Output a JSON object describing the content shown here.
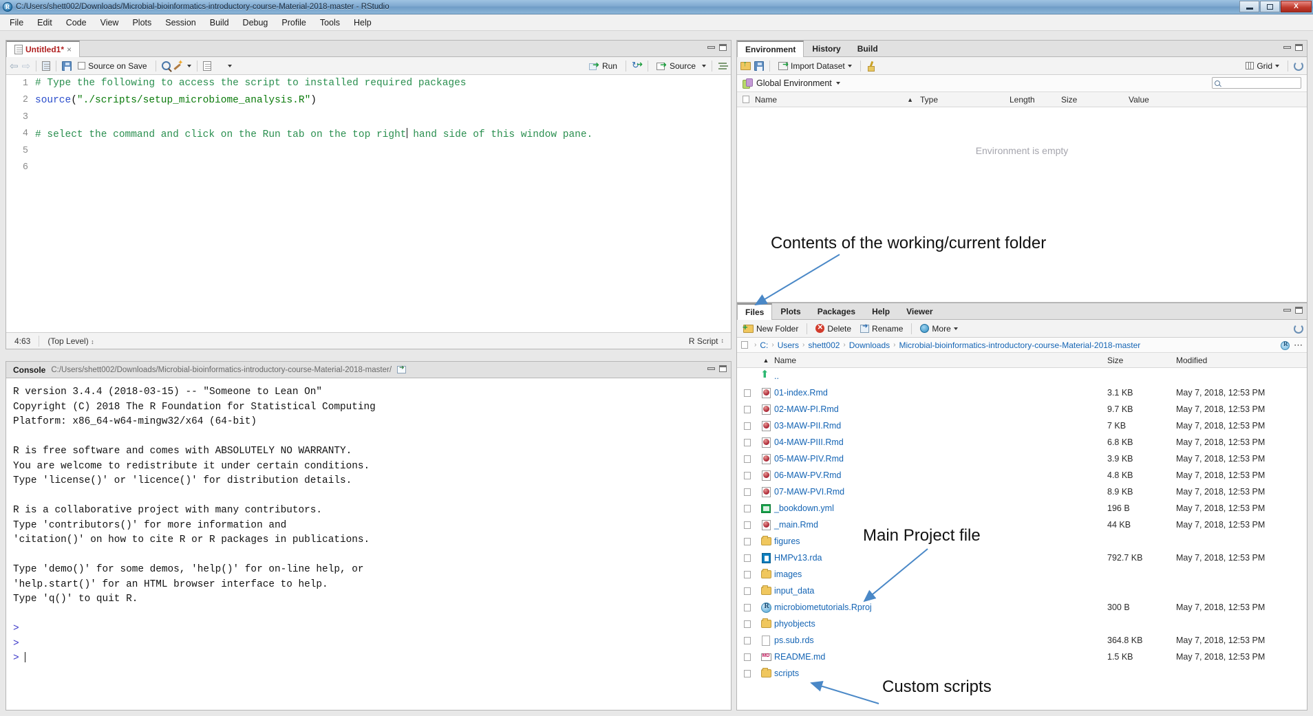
{
  "window": {
    "title": "C:/Users/shett002/Downloads/Microbial-bioinformatics-introductory-course-Material-2018-master - RStudio",
    "app_icon": "rstudio-icon",
    "minimize": "minimize-icon",
    "maximize": "maximize-icon",
    "close": "X"
  },
  "menubar": [
    "File",
    "Edit",
    "Code",
    "View",
    "Plots",
    "Session",
    "Build",
    "Debug",
    "Profile",
    "Tools",
    "Help"
  ],
  "source": {
    "tab_label": "Untitled1*",
    "tab_close": "×",
    "toolbar": {
      "back": "⇦",
      "forward": "⇨",
      "show_in_window": "show-in-new-window-icon",
      "save": "save-icon",
      "source_on_save": "Source on Save",
      "find": "find-icon",
      "code_tools": "code-tools-icon",
      "compile_report": "compile-report-icon",
      "run": "Run",
      "rerun": "re-run-icon",
      "source_btn": "Source",
      "outline": "outline-icon"
    },
    "lines": [
      {
        "n": "1",
        "tokens": [
          {
            "t": "# Type the following to access the script to installed required packages",
            "c": "c-comment"
          }
        ]
      },
      {
        "n": "2",
        "tokens": [
          {
            "t": "source",
            "c": "c-fn"
          },
          {
            "t": "(",
            "c": "c-plain"
          },
          {
            "t": "\"./scripts/setup_microbiome_analysis.R\"",
            "c": "c-str"
          },
          {
            "t": ")",
            "c": "c-plain"
          }
        ]
      },
      {
        "n": "3",
        "tokens": []
      },
      {
        "n": "4",
        "tokens": [
          {
            "t": "# select the command and click on the Run tab on the top right",
            "c": "c-comment"
          },
          {
            "t": "|CURSOR|",
            "c": "cursor"
          },
          {
            "t": " hand side of this window pane.",
            "c": "c-comment"
          }
        ]
      },
      {
        "n": "5",
        "tokens": []
      },
      {
        "n": "6",
        "tokens": []
      }
    ],
    "status": {
      "position": "4:63",
      "scope": "(Top Level)",
      "scope_stepper": "↕",
      "filetype": "R Script",
      "filetype_stepper": "↕"
    }
  },
  "console": {
    "tab_label": "Console",
    "path": "C:/Users/shett002/Downloads/Microbial-bioinformatics-introductory-course-Material-2018-master/",
    "shell_icon": "open-in-shell-icon",
    "output": [
      "R version 3.4.4 (2018-03-15) -- \"Someone to Lean On\"",
      "Copyright (C) 2018 The R Foundation for Statistical Computing",
      "Platform: x86_64-w64-mingw32/x64 (64-bit)",
      "",
      "R is free software and comes with ABSOLUTELY NO WARRANTY.",
      "You are welcome to redistribute it under certain conditions.",
      "Type 'license()' or 'licence()' for distribution details.",
      "",
      "R is a collaborative project with many contributors.",
      "Type 'contributors()' for more information and",
      "'citation()' on how to cite R or R packages in publications.",
      "",
      "Type 'demo()' for some demos, 'help()' for on-line help, or",
      "'help.start()' for an HTML browser interface to help.",
      "Type 'q()' to quit R.",
      ""
    ],
    "prompt": ">",
    "prompt_lines": 3
  },
  "environment": {
    "tabs": [
      "Environment",
      "History",
      "Build"
    ],
    "active_tab": "Environment",
    "toolbar": {
      "load": "load-workspace-icon",
      "save": "save-workspace-icon",
      "import_dataset": "Import Dataset",
      "clear": "clear-workspace-icon",
      "view_mode": "Grid",
      "refresh": "refresh-icon"
    },
    "scope": "Global Environment",
    "search_placeholder": "",
    "columns": [
      "Name",
      "Type",
      "Length",
      "Size",
      "Value"
    ],
    "sort_indicator": "▲",
    "empty_message": "Environment is empty"
  },
  "files": {
    "tabs": [
      "Files",
      "Plots",
      "Packages",
      "Help",
      "Viewer"
    ],
    "active_tab": "Files",
    "toolbar": {
      "new_folder": "New Folder",
      "delete": "Delete",
      "rename": "Rename",
      "more": "More",
      "refresh": "refresh-icon"
    },
    "breadcrumb": [
      "C:",
      "Users",
      "shett002",
      "Downloads",
      "Microbial-bioinformatics-introductory-course-Material-2018-master"
    ],
    "breadcrumb_actions": {
      "project": "rproject-icon",
      "more": "⋯"
    },
    "columns": {
      "name": "Name",
      "size": "Size",
      "modified": "Modified"
    },
    "sort_indicator": "▲",
    "parent_row": {
      "name": "..",
      "icon": "up-arrow-icon"
    },
    "rows": [
      {
        "icon": "rmd-file-icon",
        "name": "01-index.Rmd",
        "size": "3.1 KB",
        "modified": "May 7, 2018, 12:53 PM"
      },
      {
        "icon": "rmd-file-icon",
        "name": "02-MAW-PI.Rmd",
        "size": "9.7 KB",
        "modified": "May 7, 2018, 12:53 PM"
      },
      {
        "icon": "rmd-file-icon",
        "name": "03-MAW-PII.Rmd",
        "size": "7 KB",
        "modified": "May 7, 2018, 12:53 PM"
      },
      {
        "icon": "rmd-file-icon",
        "name": "04-MAW-PIII.Rmd",
        "size": "6.8 KB",
        "modified": "May 7, 2018, 12:53 PM"
      },
      {
        "icon": "rmd-file-icon",
        "name": "05-MAW-PIV.Rmd",
        "size": "3.9 KB",
        "modified": "May 7, 2018, 12:53 PM"
      },
      {
        "icon": "rmd-file-icon",
        "name": "06-MAW-PV.Rmd",
        "size": "4.8 KB",
        "modified": "May 7, 2018, 12:53 PM"
      },
      {
        "icon": "rmd-file-icon",
        "name": "07-MAW-PVI.Rmd",
        "size": "8.9 KB",
        "modified": "May 7, 2018, 12:53 PM"
      },
      {
        "icon": "yml-file-icon",
        "name": "_bookdown.yml",
        "size": "196 B",
        "modified": "May 7, 2018, 12:53 PM"
      },
      {
        "icon": "rmd-file-icon",
        "name": "_main.Rmd",
        "size": "44 KB",
        "modified": "May 7, 2018, 12:53 PM"
      },
      {
        "icon": "folder-icon",
        "name": "figures",
        "size": "",
        "modified": ""
      },
      {
        "icon": "rda-file-icon",
        "name": "HMPv13.rda",
        "size": "792.7 KB",
        "modified": "May 7, 2018, 12:53 PM"
      },
      {
        "icon": "folder-icon",
        "name": "images",
        "size": "",
        "modified": ""
      },
      {
        "icon": "folder-icon",
        "name": "input_data",
        "size": "",
        "modified": ""
      },
      {
        "icon": "rproject-icon",
        "name": "microbiometutorials.Rproj",
        "size": "300 B",
        "modified": "May 7, 2018, 12:53 PM"
      },
      {
        "icon": "folder-icon",
        "name": "phyobjects",
        "size": "",
        "modified": ""
      },
      {
        "icon": "blank-file-icon",
        "name": "ps.sub.rds",
        "size": "364.8 KB",
        "modified": "May 7, 2018, 12:53 PM"
      },
      {
        "icon": "md-file-icon",
        "name": "README.md",
        "size": "1.5 KB",
        "modified": "May 7, 2018, 12:53 PM"
      },
      {
        "icon": "folder-icon",
        "name": "scripts",
        "size": "",
        "modified": ""
      }
    ]
  },
  "annotations": [
    {
      "text": "Contents of the working/current folder",
      "name": "annotation-folder-contents"
    },
    {
      "text": "Main Project file",
      "name": "annotation-main-project-file"
    },
    {
      "text": "Custom scripts",
      "name": "annotation-custom-scripts"
    }
  ],
  "colors": {
    "annotation_arrow": "#4a88c7",
    "link": "#1464b4",
    "comment": "#2a8f4f",
    "string": "#0a7a0a",
    "function": "#2b4ecc",
    "prompt": "#3a36c8"
  }
}
